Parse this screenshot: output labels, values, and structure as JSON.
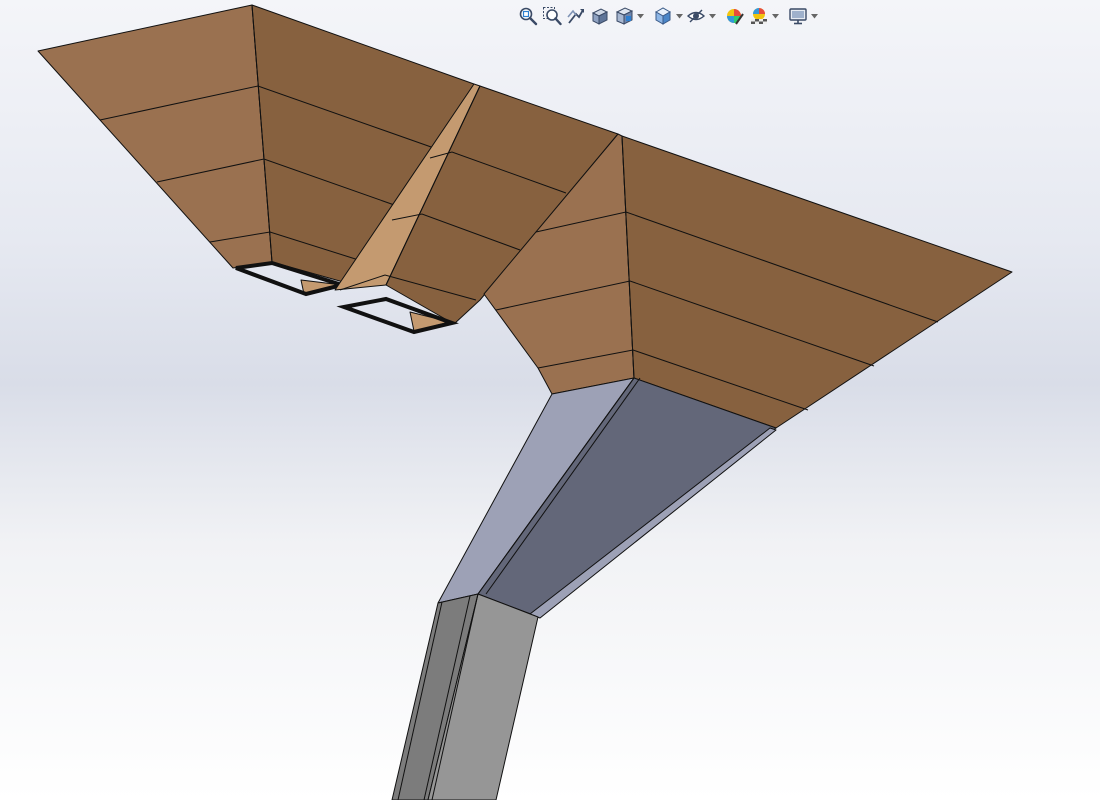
{
  "app": {
    "view": "3d-part-viewport"
  },
  "toolbar": {
    "buttons": [
      {
        "icon": "zoom-to-fit-icon",
        "dropdown": false
      },
      {
        "icon": "zoom-to-area-icon",
        "dropdown": false
      },
      {
        "icon": "previous-view-icon",
        "dropdown": false
      },
      {
        "icon": "section-view-icon",
        "dropdown": false
      },
      {
        "icon": "view-orientation-icon",
        "dropdown": true
      },
      {
        "icon": "display-style-icon",
        "dropdown": true
      },
      {
        "icon": "hide-show-items-icon",
        "dropdown": true
      },
      {
        "icon": "edit-appearance-icon",
        "dropdown": false
      },
      {
        "icon": "apply-scene-icon",
        "dropdown": true
      },
      {
        "icon": "view-settings-icon",
        "dropdown": true
      }
    ]
  },
  "model": {
    "colors": {
      "hopper_light": "#b78b63",
      "hopper_mid": "#9a7150",
      "hopper_dark": "#87613f",
      "hopper_inner": "#c49a70",
      "duct_light": "#9da1b6",
      "duct_dark": "#636779",
      "pipe_light": "#969696",
      "pipe_dark": "#7c7c7c",
      "edge": "#111111"
    }
  }
}
